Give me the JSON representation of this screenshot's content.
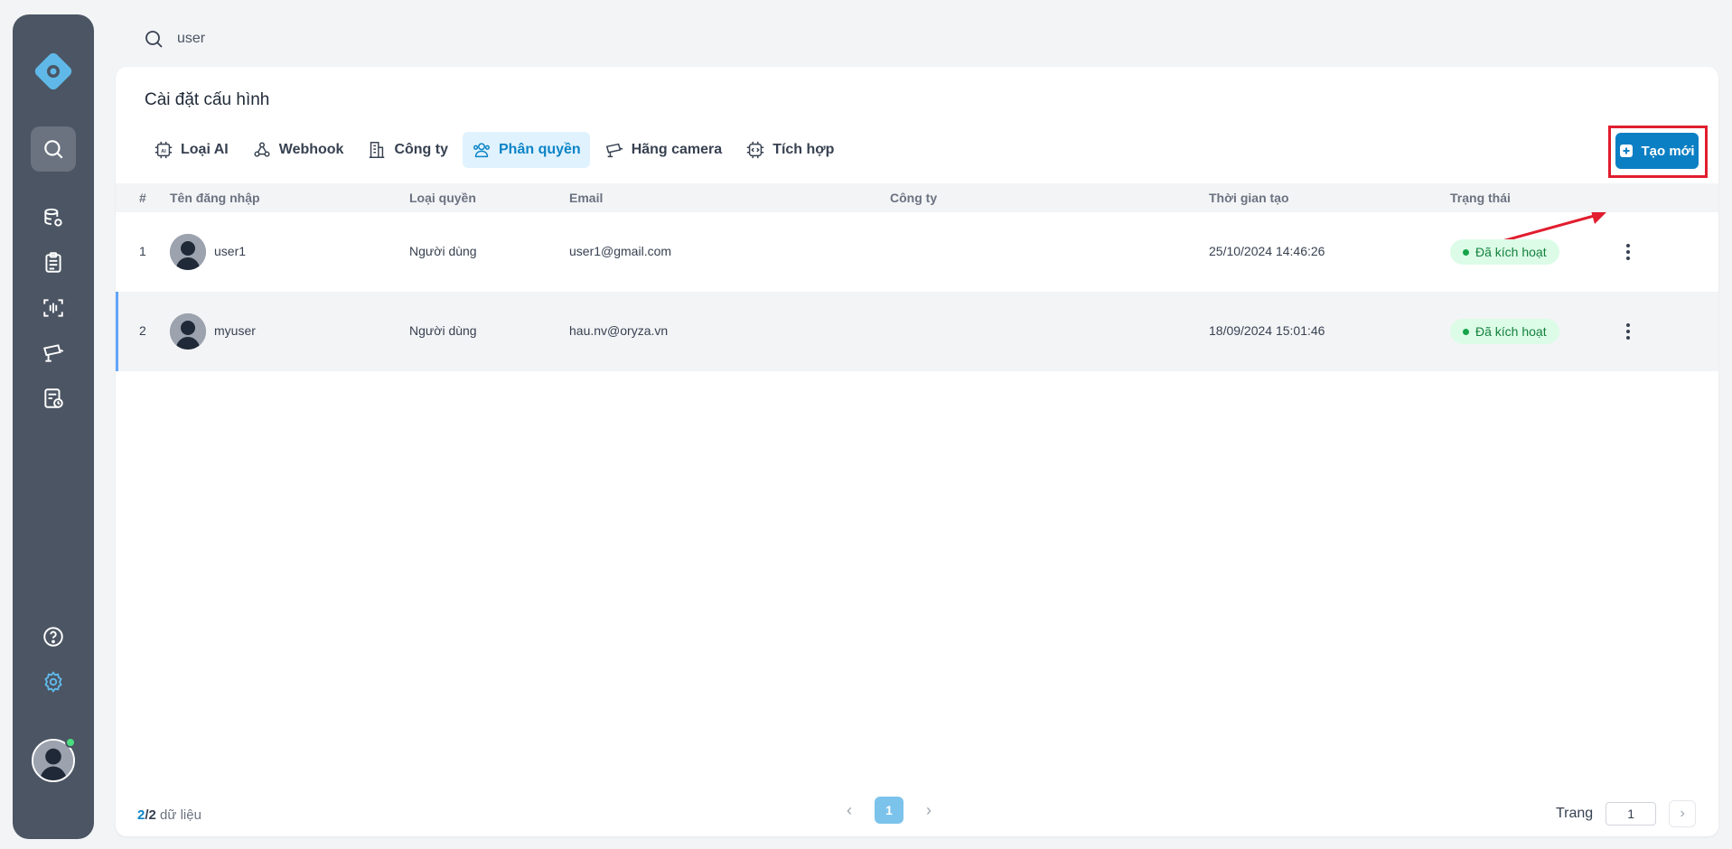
{
  "search": {
    "value": "user"
  },
  "page": {
    "title": "Cài đặt cấu hình"
  },
  "tabs": [
    {
      "label": "Loại AI",
      "icon": "ai-chip-icon"
    },
    {
      "label": "Webhook",
      "icon": "webhook-icon"
    },
    {
      "label": "Công ty",
      "icon": "building-icon"
    },
    {
      "label": "Phân quyền",
      "icon": "users-permission-icon",
      "active": true
    },
    {
      "label": "Hãng camera",
      "icon": "camera-icon"
    },
    {
      "label": "Tích hợp",
      "icon": "integration-chip-icon"
    }
  ],
  "create_button": {
    "label": "Tạo mới"
  },
  "table": {
    "headers": {
      "index": "#",
      "username": "Tên đăng nhập",
      "role": "Loại quyền",
      "email": "Email",
      "company": "Công ty",
      "created": "Thời gian tạo",
      "status": "Trạng thái"
    },
    "rows": [
      {
        "index": "1",
        "username": "user1",
        "role": "Người dùng",
        "email": "user1@gmail.com",
        "company": "",
        "created": "25/10/2024 14:46:26",
        "status": "Đã kích hoạt"
      },
      {
        "index": "2",
        "username": "myuser",
        "role": "Người dùng",
        "email": "hau.nv@oryza.vn",
        "company": "",
        "created": "18/09/2024 15:01:46",
        "status": "Đã kích hoạt"
      }
    ]
  },
  "footer": {
    "shown": "2",
    "total": "/2",
    "suffix": " dữ liệu",
    "current_page": "1",
    "page_label": "Trang",
    "page_input": "1"
  },
  "colors": {
    "accent": "#0b84c6",
    "sidebar": "#4b5563",
    "highlight_box": "#e11d2e",
    "status_green": "#15803d"
  }
}
